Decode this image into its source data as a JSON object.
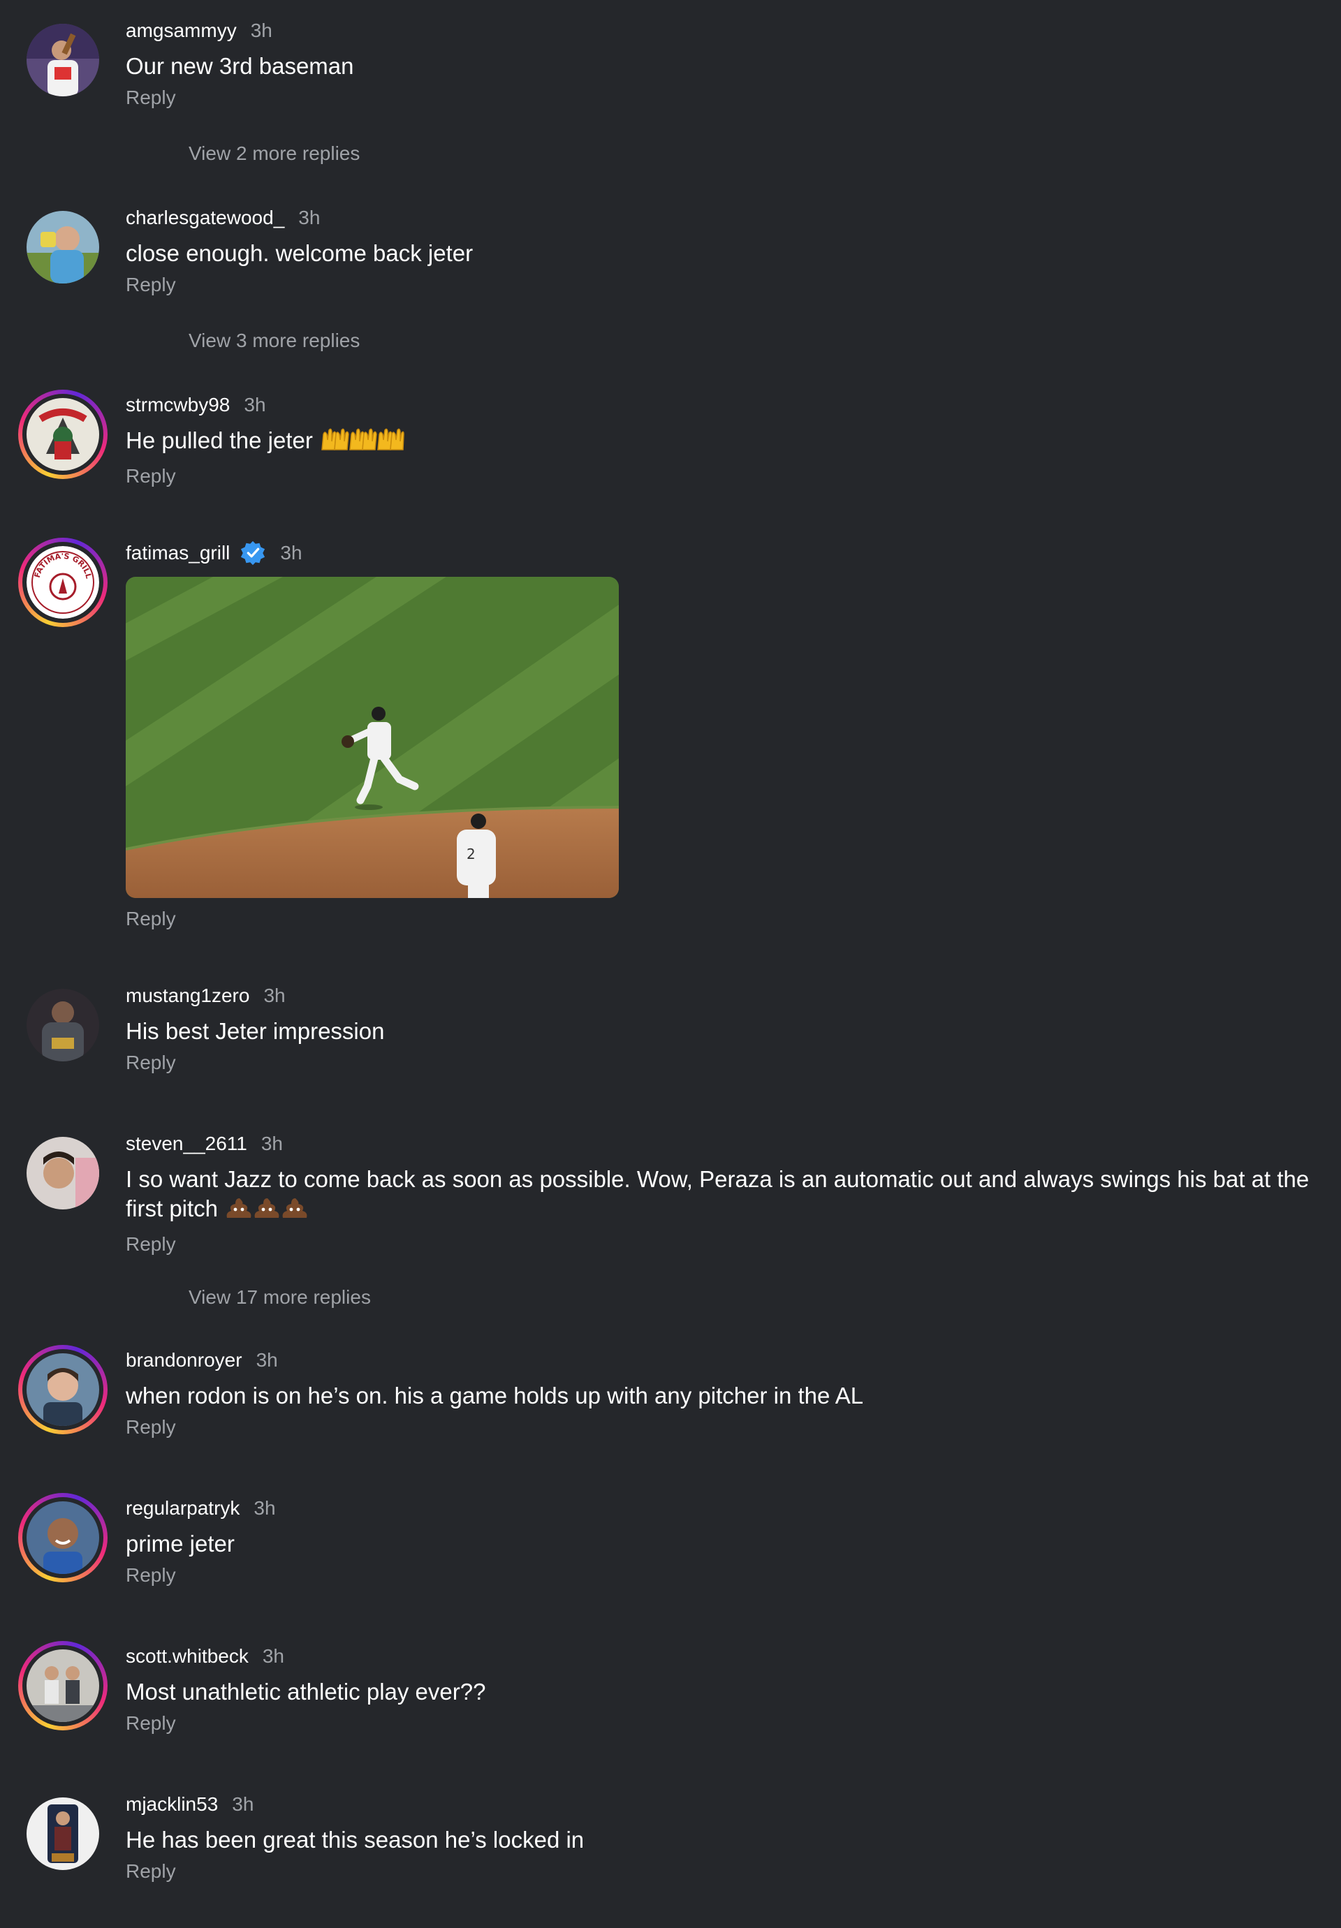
{
  "comments": [
    {
      "username": "amgsammyy",
      "time": "3h",
      "text": "Our new 3rd baseman",
      "reply": "Reply",
      "view_more": "View 2 more replies"
    },
    {
      "username": "charlesgatewood_",
      "time": "3h",
      "text": "close enough. welcome back jeter",
      "reply": "Reply",
      "view_more": "View 3 more replies"
    },
    {
      "username": "strmcwby98",
      "time": "3h",
      "text": "He pulled the jeter",
      "emoji": "raising-hands-emoji x3",
      "reply": "Reply"
    },
    {
      "username": "fatimas_grill",
      "verified": true,
      "time": "3h",
      "media": "gif",
      "reply": "Reply"
    },
    {
      "username": "mustang1zero",
      "time": "3h",
      "text": "His best Jeter impression",
      "reply": "Reply"
    },
    {
      "username": "steven__2611",
      "time": "3h",
      "text": "I so want Jazz to come back as soon as possible. Wow, Peraza is an automatic out and always swings his bat at the",
      "text_line2": "first pitch",
      "emoji": "pile-of-poo-emoji x3",
      "reply": "Reply",
      "view_more": "View 17 more replies"
    },
    {
      "username": "brandonroyer",
      "time": "3h",
      "text": "when rodon is on he’s on. his a game holds up with any pitcher in the AL",
      "reply": "Reply"
    },
    {
      "username": "regularpatryk",
      "time": "3h",
      "text": "prime jeter",
      "reply": "Reply"
    },
    {
      "username": "scott.whitbeck",
      "time": "3h",
      "text": "Most unathletic athletic play ever??",
      "reply": "Reply"
    },
    {
      "username": "mjacklin53",
      "time": "3h",
      "text": "He has been great this season he’s locked in",
      "reply": "Reply"
    }
  ],
  "colors": {
    "background": "#25272b",
    "primary_text": "#ffffff",
    "secondary_text": "#a0a3a8",
    "verified": "#3897f0",
    "story_ring": [
      "#f9ce34",
      "#ee2a7b",
      "#6228d7"
    ]
  },
  "fatimas_logo_text": "FATIMA'S GRILL"
}
